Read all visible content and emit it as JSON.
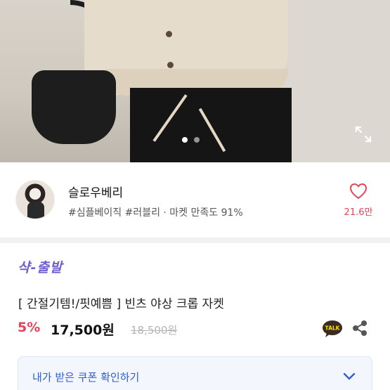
{
  "gallery": {
    "expand_icon": "expand-icon",
    "dots_count": 2,
    "active_dot": 1
  },
  "seller": {
    "name": "슬로우베리",
    "tags": "#심플베이직 #러블리 · 마켓 만족도 91%",
    "like_icon": "heart-icon",
    "like_count": "21.6만"
  },
  "product": {
    "brand": "샥-출발",
    "title": "[ 간절기템!/핏예쁨 ] 빈츠 야상 크롭 자켓",
    "discount": "5%",
    "price": "17,500원",
    "original_price": "18,500원",
    "talk_icon": "talk-icon",
    "talk_label": "TALK",
    "share_icon": "share-icon"
  },
  "coupon": {
    "label": "내가 받은 쿠폰 확인하기",
    "chevron_icon": "chevron-down-icon"
  },
  "colors": {
    "accent": "#e5435a",
    "brand": "#6f5fd0",
    "link": "#2f5fd2"
  }
}
